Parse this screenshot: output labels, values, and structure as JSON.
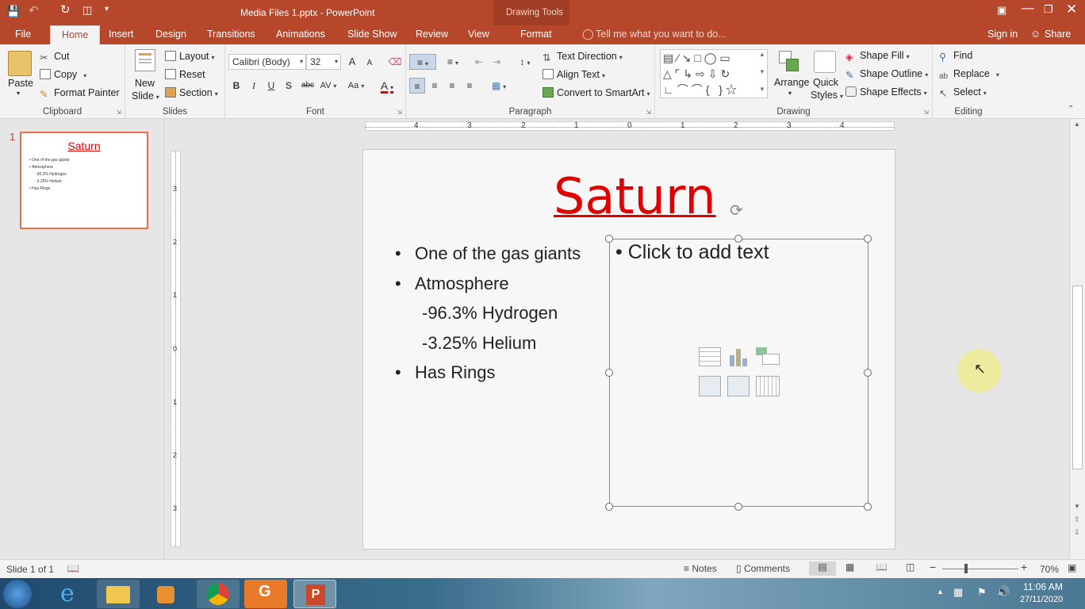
{
  "titlebar": {
    "doc_title": "Media Files 1.pptx - PowerPoint",
    "context_tab": "Drawing Tools"
  },
  "tabs": {
    "file": "File",
    "home": "Home",
    "insert": "Insert",
    "design": "Design",
    "transitions": "Transitions",
    "animations": "Animations",
    "slideshow": "Slide Show",
    "review": "Review",
    "view": "View",
    "format": "Format",
    "tellme": "Tell me what you want to do...",
    "signin": "Sign in",
    "share": "Share"
  },
  "ribbon": {
    "clipboard": {
      "paste": "Paste",
      "cut": "Cut",
      "copy": "Copy",
      "format_painter": "Format Painter",
      "label": "Clipboard"
    },
    "slides": {
      "new_slide_1": "New",
      "new_slide_2": "Slide",
      "layout": "Layout",
      "reset": "Reset",
      "section": "Section",
      "label": "Slides"
    },
    "font": {
      "name": "Calibri (Body)",
      "size": "32",
      "bold": "B",
      "italic": "I",
      "underline": "U",
      "shadow": "S",
      "strike": "abc",
      "spacing": "AV",
      "case": "Aa",
      "color": "A",
      "grow": "A",
      "shrink": "A",
      "label": "Font"
    },
    "paragraph": {
      "text_direction": "Text Direction",
      "align_text": "Align Text",
      "smartart": "Convert to SmartArt",
      "label": "Paragraph"
    },
    "drawing": {
      "arrange": "Arrange",
      "quick_styles_1": "Quick",
      "quick_styles_2": "Styles",
      "shape_fill": "Shape Fill",
      "shape_outline": "Shape Outline",
      "shape_effects": "Shape Effects",
      "label": "Drawing"
    },
    "editing": {
      "find": "Find",
      "replace": "Replace",
      "select": "Select",
      "label": "Editing"
    }
  },
  "ruler": {
    "h_ticks": [
      "4",
      "3",
      "2",
      "1",
      "0",
      "1",
      "2",
      "3",
      "4"
    ],
    "v_ticks": [
      "3",
      "2",
      "1",
      "0",
      "1",
      "2",
      "3"
    ]
  },
  "thumbnail": {
    "number": "1",
    "title": "Saturn",
    "lines": [
      "One of the gas giants",
      "Atmosphere",
      "-96.3% Hydrogen",
      "-3.25% Helium",
      "Has Rings"
    ]
  },
  "slide": {
    "title": "Saturn",
    "bullets": [
      {
        "text": "One of the gas giants",
        "bullet": "•"
      },
      {
        "text": "Atmosphere",
        "bullet": "•"
      },
      {
        "text": "-96.3% Hydrogen",
        "bullet": ""
      },
      {
        "text": "-3.25% Helium",
        "bullet": ""
      },
      {
        "text": "Has Rings",
        "bullet": "•"
      }
    ],
    "placeholder": "Click to add text",
    "placeholder_bullet": "•",
    "title_color": "#e00000"
  },
  "status": {
    "slide_info": "Slide 1 of 1",
    "notes": "Notes",
    "comments": "Comments",
    "zoom": "70%"
  },
  "taskbar": {
    "time": "11:06 AM",
    "date": "27/11/2020"
  },
  "colors": {
    "accent": "#b7472a",
    "thumb_border": "#e8704c"
  }
}
